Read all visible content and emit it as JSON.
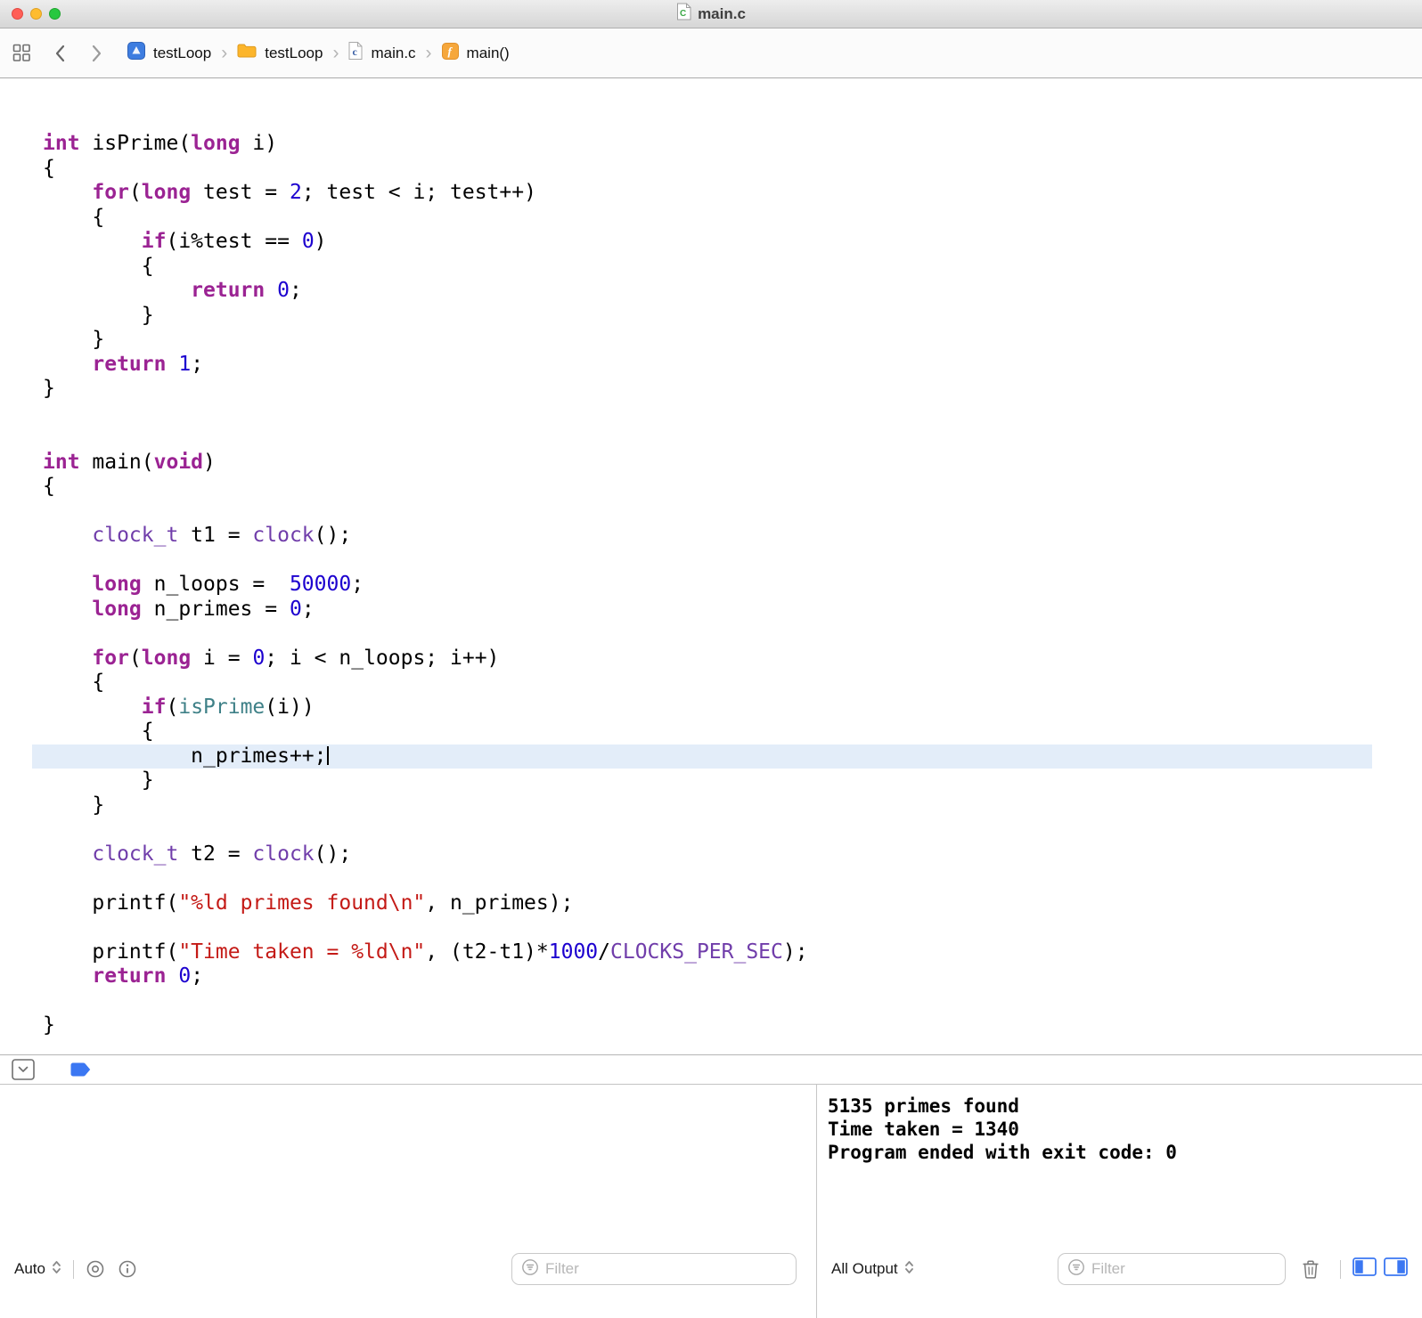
{
  "window": {
    "title": "main.c"
  },
  "jumpbar": {
    "separator": "›",
    "items": [
      {
        "label": "testLoop"
      },
      {
        "label": "testLoop"
      },
      {
        "label": "main.c"
      },
      {
        "label": "main()"
      }
    ]
  },
  "editor": {
    "lines": [
      {
        "t": [
          [
            "kw",
            "int"
          ],
          [
            "pl",
            " isPrime("
          ],
          [
            "kw",
            "long"
          ],
          [
            "pl",
            " i)"
          ]
        ]
      },
      {
        "t": [
          [
            "pl",
            "{"
          ]
        ]
      },
      {
        "t": [
          [
            "pl",
            "    "
          ],
          [
            "kw",
            "for"
          ],
          [
            "pl",
            "("
          ],
          [
            "kw",
            "long"
          ],
          [
            "pl",
            " test = "
          ],
          [
            "num",
            "2"
          ],
          [
            "pl",
            "; test < i; test++)"
          ]
        ]
      },
      {
        "t": [
          [
            "pl",
            "    {"
          ]
        ]
      },
      {
        "t": [
          [
            "pl",
            "        "
          ],
          [
            "kw",
            "if"
          ],
          [
            "pl",
            "(i%test == "
          ],
          [
            "num",
            "0"
          ],
          [
            "pl",
            ")"
          ]
        ]
      },
      {
        "t": [
          [
            "pl",
            "        {"
          ]
        ]
      },
      {
        "t": [
          [
            "pl",
            "            "
          ],
          [
            "kw",
            "return"
          ],
          [
            "pl",
            " "
          ],
          [
            "num",
            "0"
          ],
          [
            "pl",
            ";"
          ]
        ]
      },
      {
        "t": [
          [
            "pl",
            "        }"
          ]
        ]
      },
      {
        "t": [
          [
            "pl",
            "    }"
          ]
        ]
      },
      {
        "t": [
          [
            "pl",
            "    "
          ],
          [
            "kw",
            "return"
          ],
          [
            "pl",
            " "
          ],
          [
            "num",
            "1"
          ],
          [
            "pl",
            ";"
          ]
        ]
      },
      {
        "t": [
          [
            "pl",
            "}"
          ]
        ]
      },
      {
        "t": []
      },
      {
        "t": []
      },
      {
        "t": [
          [
            "kw",
            "int"
          ],
          [
            "pl",
            " main("
          ],
          [
            "kw",
            "void"
          ],
          [
            "pl",
            ")"
          ]
        ]
      },
      {
        "t": [
          [
            "pl",
            "{"
          ]
        ]
      },
      {
        "t": []
      },
      {
        "t": [
          [
            "pl",
            "    "
          ],
          [
            "typ",
            "clock_t"
          ],
          [
            "pl",
            " t1 = "
          ],
          [
            "typ",
            "clock"
          ],
          [
            "pl",
            "();"
          ]
        ]
      },
      {
        "t": []
      },
      {
        "t": [
          [
            "pl",
            "    "
          ],
          [
            "kw",
            "long"
          ],
          [
            "pl",
            " n_loops =  "
          ],
          [
            "num",
            "50000"
          ],
          [
            "pl",
            ";"
          ]
        ]
      },
      {
        "t": [
          [
            "pl",
            "    "
          ],
          [
            "kw",
            "long"
          ],
          [
            "pl",
            " n_primes = "
          ],
          [
            "num",
            "0"
          ],
          [
            "pl",
            ";"
          ]
        ]
      },
      {
        "t": []
      },
      {
        "t": [
          [
            "pl",
            "    "
          ],
          [
            "kw",
            "for"
          ],
          [
            "pl",
            "("
          ],
          [
            "kw",
            "long"
          ],
          [
            "pl",
            " i = "
          ],
          [
            "num",
            "0"
          ],
          [
            "pl",
            "; i < n_loops; i++)"
          ]
        ]
      },
      {
        "t": [
          [
            "pl",
            "    {"
          ]
        ]
      },
      {
        "t": [
          [
            "pl",
            "        "
          ],
          [
            "kw",
            "if"
          ],
          [
            "pl",
            "("
          ],
          [
            "fn",
            "isPrime"
          ],
          [
            "pl",
            "(i))"
          ]
        ]
      },
      {
        "t": [
          [
            "pl",
            "        {"
          ]
        ]
      },
      {
        "t": [
          [
            "pl",
            "            n_primes++;"
          ]
        ],
        "hl": true,
        "caret": true
      },
      {
        "t": [
          [
            "pl",
            "        }"
          ]
        ]
      },
      {
        "t": [
          [
            "pl",
            "    }"
          ]
        ]
      },
      {
        "t": []
      },
      {
        "t": [
          [
            "pl",
            "    "
          ],
          [
            "typ",
            "clock_t"
          ],
          [
            "pl",
            " t2 = "
          ],
          [
            "typ",
            "clock"
          ],
          [
            "pl",
            "();"
          ]
        ]
      },
      {
        "t": []
      },
      {
        "t": [
          [
            "pl",
            "    printf("
          ],
          [
            "str",
            "\"%ld primes found\\n\""
          ],
          [
            "pl",
            ", n_primes);"
          ]
        ]
      },
      {
        "t": []
      },
      {
        "t": [
          [
            "pl",
            "    printf("
          ],
          [
            "str",
            "\"Time taken = %ld\\n\""
          ],
          [
            "pl",
            ", (t2-t1)*"
          ],
          [
            "num",
            "1000"
          ],
          [
            "pl",
            "/"
          ],
          [
            "typ",
            "CLOCKS_PER_SEC"
          ],
          [
            "pl",
            ");"
          ]
        ]
      },
      {
        "t": [
          [
            "pl",
            "    "
          ],
          [
            "kw",
            "return"
          ],
          [
            "pl",
            " "
          ],
          [
            "num",
            "0"
          ],
          [
            "pl",
            ";"
          ]
        ]
      },
      {
        "t": []
      },
      {
        "t": [
          [
            "pl",
            "}"
          ]
        ]
      }
    ]
  },
  "console": {
    "lines": [
      "5135 primes found",
      "Time taken = 1340",
      "Program ended with exit code: 0"
    ]
  },
  "debugbar": {
    "variables_scope": "Auto",
    "output_scope": "All Output",
    "filter_placeholder": "Filter"
  },
  "colors": {
    "kw": "#9B2393",
    "num": "#1C00CF",
    "str": "#C41A16",
    "typ": "#703DAA",
    "fn": "#3E8087",
    "highlight": "#E3EDF9",
    "tl_red": "#FF5F57",
    "tl_yellow": "#FEBC2E",
    "tl_green": "#28C840",
    "accent_blue": "#3B77F2"
  }
}
